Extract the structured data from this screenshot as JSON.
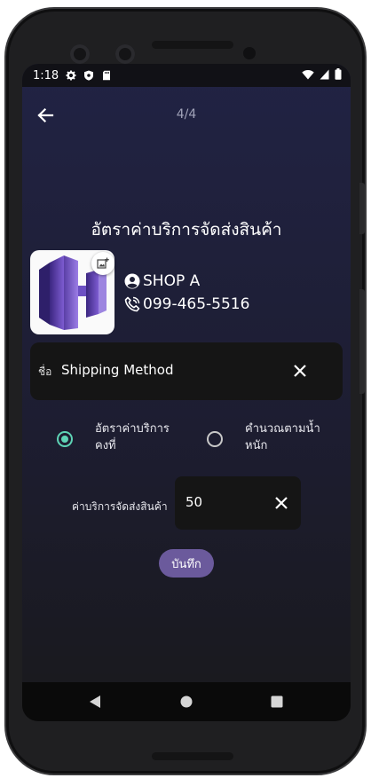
{
  "status_bar": {
    "time": "1:18",
    "left_icons": [
      "gear-icon",
      "shield-icon",
      "sd-card-icon"
    ],
    "right_icons": [
      "wifi-icon",
      "signal-icon",
      "battery-icon"
    ]
  },
  "header": {
    "page_indicator": "4/4"
  },
  "title": "อัตราค่าบริการจัดส่งสินค้า",
  "shop": {
    "name": "SHOP A",
    "phone": "099-465-5516"
  },
  "name_field": {
    "label": "ชื่อ",
    "value": "Shipping Method"
  },
  "rate_options": [
    {
      "label": "อัตราค่าบริการ\nคงที่",
      "selected": true
    },
    {
      "label": "คำนวณตามน้ำ\nหนัก",
      "selected": false
    }
  ],
  "fee": {
    "label": "ค่าบริการจัดส่งสินค้า",
    "value": "50"
  },
  "save_label": "บันทึก",
  "colors": {
    "accent_radio": "#5ed3b5",
    "save_button": "#6b5a9c",
    "logo_purple": "#6a4bb8"
  }
}
